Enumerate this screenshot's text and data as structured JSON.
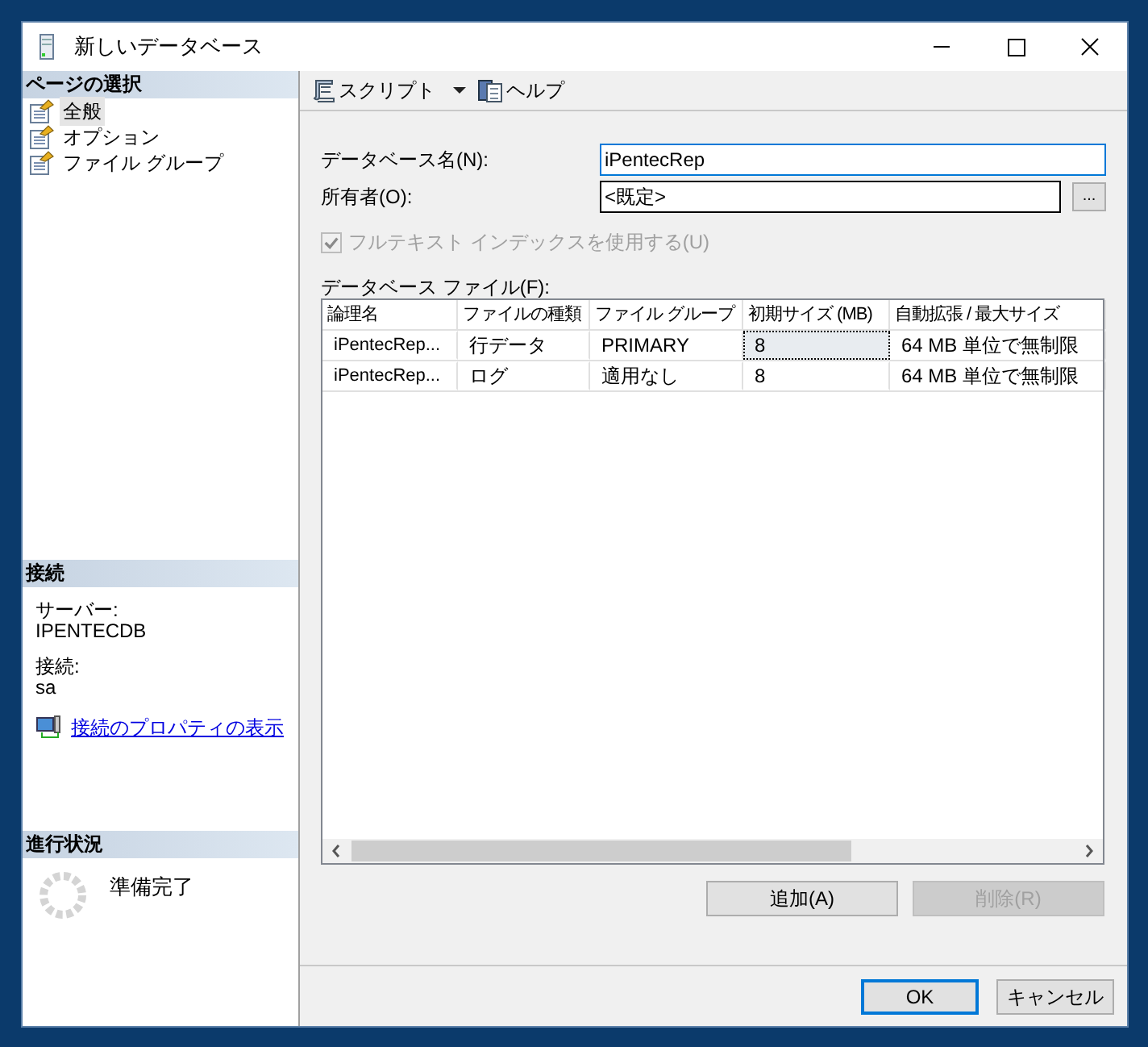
{
  "window": {
    "title": "新しいデータベース"
  },
  "page_selection": {
    "title": "ページの選択",
    "items": [
      {
        "label": "全般",
        "selected": true
      },
      {
        "label": "オプション",
        "selected": false
      },
      {
        "label": "ファイル グループ",
        "selected": false
      }
    ]
  },
  "connection": {
    "title": "接続",
    "server_label": "サーバー:",
    "server": "IPENTECDB",
    "connection_label": "接続:",
    "user": "sa",
    "link": "接続のプロパティの表示"
  },
  "progress": {
    "title": "進行状況",
    "status": "準備完了"
  },
  "toolbar": [
    {
      "kind": "script",
      "label": "スクリプト",
      "dropdown": true
    },
    {
      "kind": "help",
      "label": "ヘルプ",
      "dropdown": false
    }
  ],
  "database_name": {
    "label": "データベース名(N):",
    "value": "iPentecRep",
    "focused": true
  },
  "owner": {
    "label": "所有者(O):",
    "value": "<既定>",
    "browse": "..."
  },
  "fulltext": {
    "label": "フルテキスト インデックスを使用する(U)",
    "checked": true,
    "disabled": true
  },
  "files": {
    "label": "データベース ファイル(F):",
    "columns": [
      "論理名",
      "ファイルの種類",
      "ファイル グループ",
      "初期サイズ (MB)",
      "自動拡張 / 最大サイズ"
    ],
    "rows": [
      {
        "cells": [
          {
            "text": "iPentecRep...",
            "focused": false
          },
          {
            "text": "行データ",
            "focused": false
          },
          {
            "text": "PRIMARY",
            "focused": false
          },
          {
            "text": "8",
            "focused": true
          },
          {
            "text": "64 MB 単位で無制限",
            "focused": false
          }
        ]
      },
      {
        "cells": [
          {
            "text": "iPentecRep...",
            "focused": false
          },
          {
            "text": "ログ",
            "focused": false
          },
          {
            "text": "適用なし",
            "focused": false
          },
          {
            "text": "8",
            "focused": false
          },
          {
            "text": "64 MB 単位で無制限",
            "focused": false
          }
        ]
      }
    ]
  },
  "file_buttons": [
    {
      "label": "追加(A)",
      "disabled": false
    },
    {
      "label": "削除(R)",
      "disabled": true
    }
  ],
  "dialog_buttons": [
    {
      "label": "OK",
      "default": true
    },
    {
      "label": "キャンセル",
      "default": false
    }
  ]
}
